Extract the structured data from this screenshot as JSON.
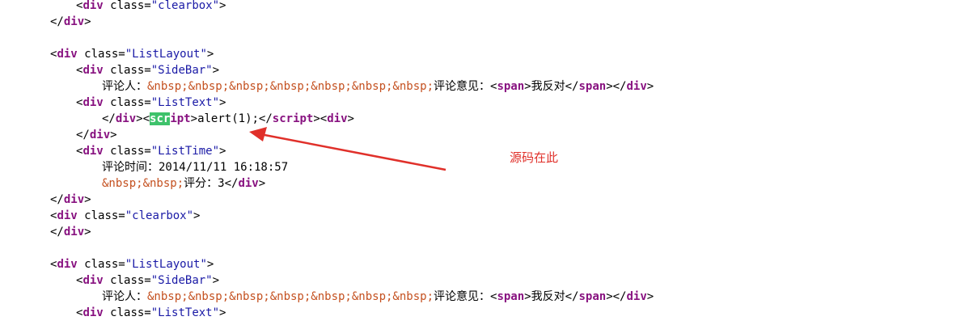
{
  "lines": [
    {
      "indent": 1,
      "tokens": [
        {
          "t": "<",
          "c": "punc"
        },
        {
          "t": "div",
          "c": "tag"
        },
        {
          "t": " class=",
          "c": "txt"
        },
        {
          "t": "\"clearbox\"",
          "c": "str"
        },
        {
          "t": ">",
          "c": "punc"
        }
      ]
    },
    {
      "indent": 0,
      "tokens": [
        {
          "t": "</",
          "c": "punc"
        },
        {
          "t": "div",
          "c": "tag"
        },
        {
          "t": ">",
          "c": "punc"
        }
      ]
    },
    {
      "indent": 0,
      "tokens": []
    },
    {
      "indent": 0,
      "tokens": [
        {
          "t": "<",
          "c": "punc"
        },
        {
          "t": "div",
          "c": "tag"
        },
        {
          "t": " class=",
          "c": "txt"
        },
        {
          "t": "\"ListLayout\"",
          "c": "str"
        },
        {
          "t": ">",
          "c": "punc"
        }
      ]
    },
    {
      "indent": 1,
      "tokens": [
        {
          "t": "<",
          "c": "punc"
        },
        {
          "t": "div",
          "c": "tag"
        },
        {
          "t": " class=",
          "c": "txt"
        },
        {
          "t": "\"SideBar\"",
          "c": "str"
        },
        {
          "t": ">",
          "c": "punc"
        }
      ]
    },
    {
      "indent": 2,
      "tokens": [
        {
          "t": "评论人：",
          "c": "txt"
        },
        {
          "t": "&nbsp;&nbsp;&nbsp;&nbsp;&nbsp;&nbsp;&nbsp;",
          "c": "ent"
        },
        {
          "t": "评论意见：",
          "c": "txt"
        },
        {
          "t": "<",
          "c": "punc"
        },
        {
          "t": "span",
          "c": "tag"
        },
        {
          "t": ">",
          "c": "punc"
        },
        {
          "t": "我反对",
          "c": "txt"
        },
        {
          "t": "</",
          "c": "punc"
        },
        {
          "t": "span",
          "c": "tag"
        },
        {
          "t": ">",
          "c": "punc"
        },
        {
          "t": "</",
          "c": "punc"
        },
        {
          "t": "div",
          "c": "tag"
        },
        {
          "t": ">",
          "c": "punc"
        }
      ]
    },
    {
      "indent": 1,
      "tokens": [
        {
          "t": "<",
          "c": "punc"
        },
        {
          "t": "div",
          "c": "tag"
        },
        {
          "t": " class=",
          "c": "txt"
        },
        {
          "t": "\"ListText\"",
          "c": "str"
        },
        {
          "t": ">",
          "c": "punc"
        }
      ]
    },
    {
      "indent": 2,
      "tokens": [
        {
          "t": "</",
          "c": "punc"
        },
        {
          "t": "div",
          "c": "tag"
        },
        {
          "t": ">",
          "c": "punc"
        },
        {
          "t": "<",
          "c": "punc"
        },
        {
          "t": "scr",
          "c": "tag hl"
        },
        {
          "t": "ipt",
          "c": "tag"
        },
        {
          "t": ">",
          "c": "punc"
        },
        {
          "t": "alert(1);",
          "c": "txt"
        },
        {
          "t": "</",
          "c": "punc"
        },
        {
          "t": "script",
          "c": "tag"
        },
        {
          "t": ">",
          "c": "punc"
        },
        {
          "t": "<",
          "c": "punc"
        },
        {
          "t": "div",
          "c": "tag"
        },
        {
          "t": ">",
          "c": "punc"
        }
      ]
    },
    {
      "indent": 1,
      "tokens": [
        {
          "t": "</",
          "c": "punc"
        },
        {
          "t": "div",
          "c": "tag"
        },
        {
          "t": ">",
          "c": "punc"
        }
      ]
    },
    {
      "indent": 1,
      "tokens": [
        {
          "t": "<",
          "c": "punc"
        },
        {
          "t": "div",
          "c": "tag"
        },
        {
          "t": " class=",
          "c": "txt"
        },
        {
          "t": "\"ListTime\"",
          "c": "str"
        },
        {
          "t": ">",
          "c": "punc"
        }
      ]
    },
    {
      "indent": 2,
      "tokens": [
        {
          "t": "评论时间：2014/11/11 16:18:57",
          "c": "txt"
        }
      ]
    },
    {
      "indent": 2,
      "tokens": [
        {
          "t": "&nbsp;&nbsp;",
          "c": "ent"
        },
        {
          "t": "评分：3",
          "c": "txt"
        },
        {
          "t": "</",
          "c": "punc"
        },
        {
          "t": "div",
          "c": "tag"
        },
        {
          "t": ">",
          "c": "punc"
        }
      ]
    },
    {
      "indent": 0,
      "tokens": [
        {
          "t": "</",
          "c": "punc"
        },
        {
          "t": "div",
          "c": "tag"
        },
        {
          "t": ">",
          "c": "punc"
        }
      ]
    },
    {
      "indent": 0,
      "tokens": [
        {
          "t": "<",
          "c": "punc"
        },
        {
          "t": "div",
          "c": "tag"
        },
        {
          "t": " class=",
          "c": "txt"
        },
        {
          "t": "\"clearbox\"",
          "c": "str"
        },
        {
          "t": ">",
          "c": "punc"
        }
      ]
    },
    {
      "indent": 0,
      "tokens": [
        {
          "t": "</",
          "c": "punc"
        },
        {
          "t": "div",
          "c": "tag"
        },
        {
          "t": ">",
          "c": "punc"
        }
      ]
    },
    {
      "indent": 0,
      "tokens": []
    },
    {
      "indent": 0,
      "tokens": [
        {
          "t": "<",
          "c": "punc"
        },
        {
          "t": "div",
          "c": "tag"
        },
        {
          "t": " class=",
          "c": "txt"
        },
        {
          "t": "\"ListLayout\"",
          "c": "str"
        },
        {
          "t": ">",
          "c": "punc"
        }
      ]
    },
    {
      "indent": 1,
      "tokens": [
        {
          "t": "<",
          "c": "punc"
        },
        {
          "t": "div",
          "c": "tag"
        },
        {
          "t": " class=",
          "c": "txt"
        },
        {
          "t": "\"SideBar\"",
          "c": "str"
        },
        {
          "t": ">",
          "c": "punc"
        }
      ]
    },
    {
      "indent": 2,
      "tokens": [
        {
          "t": "评论人：",
          "c": "txt"
        },
        {
          "t": "&nbsp;&nbsp;&nbsp;&nbsp;&nbsp;&nbsp;&nbsp;",
          "c": "ent"
        },
        {
          "t": "评论意见：",
          "c": "txt"
        },
        {
          "t": "<",
          "c": "punc"
        },
        {
          "t": "span",
          "c": "tag"
        },
        {
          "t": ">",
          "c": "punc"
        },
        {
          "t": "我反对",
          "c": "txt"
        },
        {
          "t": "</",
          "c": "punc"
        },
        {
          "t": "span",
          "c": "tag"
        },
        {
          "t": ">",
          "c": "punc"
        },
        {
          "t": "</",
          "c": "punc"
        },
        {
          "t": "div",
          "c": "tag"
        },
        {
          "t": ">",
          "c": "punc"
        }
      ]
    },
    {
      "indent": 1,
      "tokens": [
        {
          "t": "<",
          "c": "punc"
        },
        {
          "t": "div",
          "c": "tag"
        },
        {
          "t": " class=",
          "c": "txt"
        },
        {
          "t": "\"ListText\"",
          "c": "str"
        },
        {
          "t": ">",
          "c": "punc"
        }
      ]
    }
  ],
  "annotation": {
    "label": "源码在此",
    "color": "#e0302a"
  },
  "colors": {
    "tag": "#881280",
    "string": "#1a1aa6",
    "entity": "#c4501f",
    "highlight": "#3ec26b"
  }
}
